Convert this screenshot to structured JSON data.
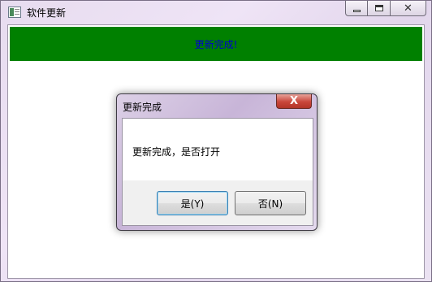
{
  "window": {
    "title": "软件更新",
    "icon": "app-window-icon",
    "controls": {
      "minimize": "minimize-icon",
      "maximize": "maximize-icon",
      "close": "close-icon"
    }
  },
  "banner": {
    "text": "更新完成!",
    "background": "#008000",
    "text_color": "#0000cc"
  },
  "dialog": {
    "title": "更新完成",
    "message": "更新完成，是否打开",
    "yes_label": "是(Y)",
    "no_label": "否(N)",
    "close_glyph": "X"
  }
}
